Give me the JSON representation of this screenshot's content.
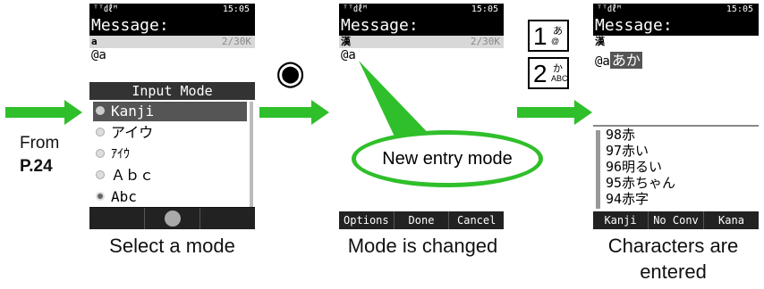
{
  "from_label": "From",
  "page_ref": "P.24",
  "center_key": "◉",
  "screens": [
    {
      "signal": "ᵀᵀ㎗ᴹ",
      "time": "15:05",
      "title": "Message:",
      "input_char": "a",
      "count": "2/30K",
      "text": "@a",
      "menu_title": "Input Mode",
      "options": [
        "Kanji",
        "アイウ",
        "ｱｲｳ",
        "Ａｂｃ",
        "Abc"
      ],
      "selected_index": 0
    },
    {
      "signal": "ᵀᵀ㎗ᴹ",
      "time": "15:05",
      "title": "Message:",
      "input_char": "漢",
      "count": "2/30K",
      "text": "@a",
      "softkeys": [
        "Options",
        "Done",
        "Cancel"
      ],
      "callout": "New entry mode"
    },
    {
      "signal": "ᵀᵀ㎗ᴹ",
      "time": "15:05",
      "title": "Message:",
      "input_char": "漢",
      "text": "@a",
      "typed": "あか",
      "candidates": [
        "98赤",
        "97赤い",
        "96明るい",
        "95赤ちゃん",
        "94赤字"
      ],
      "softkeys": [
        "Kanji",
        "No Conv",
        "Kana"
      ]
    }
  ],
  "keys": [
    {
      "num": "1",
      "kana": "あ",
      "sub": "@"
    },
    {
      "num": "2",
      "kana": "か",
      "sub": "ABC"
    }
  ],
  "captions": [
    "Select a mode",
    "Mode is changed",
    "Characters are",
    "entered"
  ]
}
